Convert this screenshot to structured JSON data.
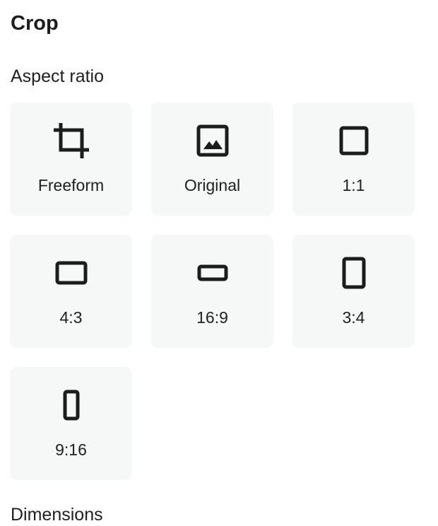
{
  "panel": {
    "title": "Crop",
    "aspect_ratio_label": "Aspect ratio",
    "dimensions_label": "Dimensions"
  },
  "aspect_options": [
    {
      "id": "freeform",
      "label": "Freeform",
      "icon": "crop-icon"
    },
    {
      "id": "original",
      "label": "Original",
      "icon": "image-icon"
    },
    {
      "id": "1-1",
      "label": "1:1",
      "icon": "square-icon"
    },
    {
      "id": "4-3",
      "label": "4:3",
      "icon": "landscape-4-3-icon"
    },
    {
      "id": "16-9",
      "label": "16:9",
      "icon": "landscape-16-9-icon"
    },
    {
      "id": "3-4",
      "label": "3:4",
      "icon": "portrait-3-4-icon"
    },
    {
      "id": "9-16",
      "label": "9:16",
      "icon": "portrait-9-16-icon"
    }
  ],
  "colors": {
    "tile_background": "#f6f7f7",
    "icon_stroke": "#1c1c1c",
    "text": "#1c1c1c"
  }
}
